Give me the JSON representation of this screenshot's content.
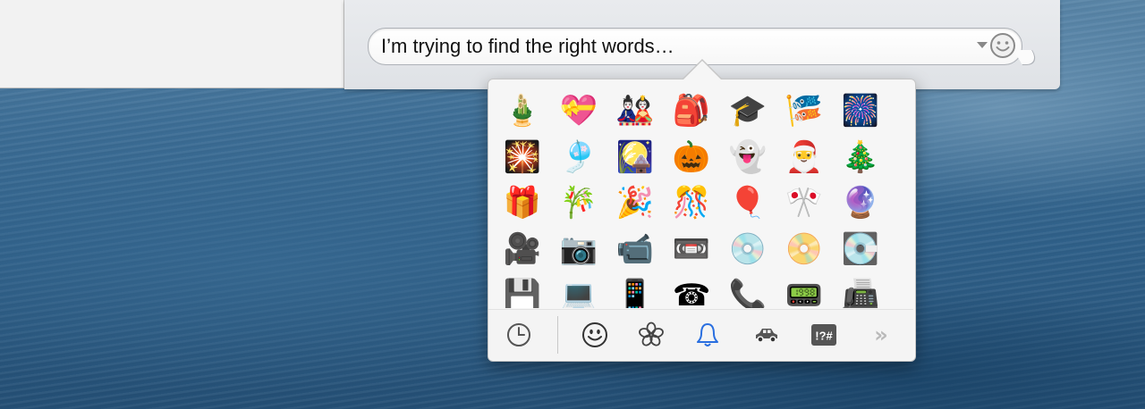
{
  "message_input": {
    "text": "I’m trying to find the right words…"
  },
  "colors": {
    "accent": "#2a6fe0",
    "icon_gray": "#555555"
  },
  "emoji_grid": [
    [
      "🎍",
      "💝",
      "🎎",
      "🎒",
      "🎓",
      "🎏",
      "🎆"
    ],
    [
      "🎇",
      "🎐",
      "🎑",
      "🎃",
      "👻",
      "🎅",
      "🎄"
    ],
    [
      "🎁",
      "🎋",
      "🎉",
      "🎊",
      "🎈",
      "🎌",
      "🔮"
    ],
    [
      "🎥",
      "📷",
      "📹",
      "📼",
      "💿",
      "📀",
      "💽"
    ],
    [
      "💾",
      "💻",
      "📱",
      "☎",
      "📞",
      "📟",
      "📠"
    ]
  ],
  "category_tabs": [
    {
      "name": "recent",
      "icon": "clock-icon",
      "active": false
    },
    {
      "name": "people",
      "icon": "smiley-icon",
      "active": false
    },
    {
      "name": "nature",
      "icon": "flower-icon",
      "active": false
    },
    {
      "name": "objects",
      "icon": "bell-icon",
      "active": true
    },
    {
      "name": "places",
      "icon": "car-icon",
      "active": false
    },
    {
      "name": "symbols",
      "icon": "symbols-icon",
      "label": "!?#",
      "active": false
    }
  ],
  "more_label": "»"
}
